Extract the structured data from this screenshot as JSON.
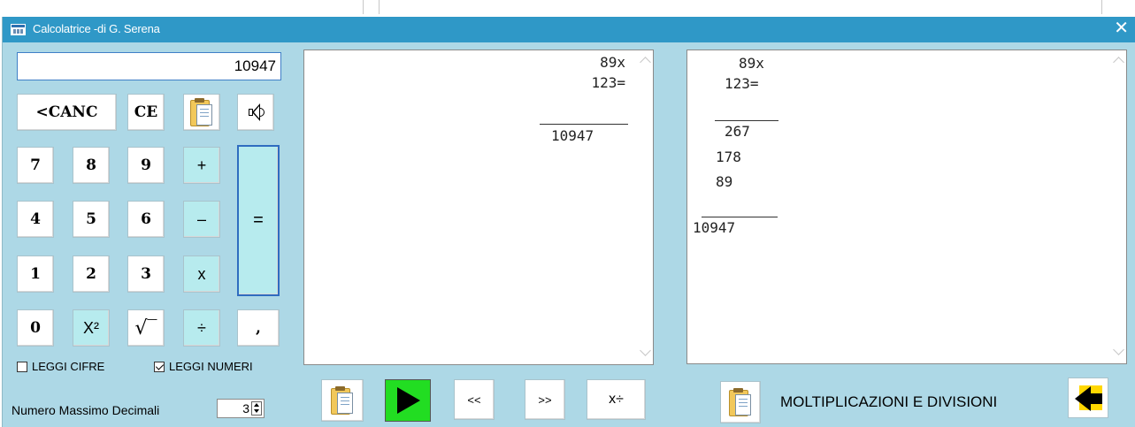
{
  "window": {
    "title": "Calcolatrice -di G. Serena",
    "close_label": "✕"
  },
  "display": {
    "value": "10947"
  },
  "keypad": {
    "cancel": "<CANC",
    "ce": "CE",
    "digits": [
      "0",
      "1",
      "2",
      "3",
      "4",
      "5",
      "6",
      "7",
      "8",
      "9"
    ],
    "plus": "+",
    "minus": "–",
    "times": "x",
    "divide": "÷",
    "equals": "=",
    "square": "X²",
    "sqrt": "√‾",
    "comma": ","
  },
  "options": {
    "leggi_cifre_label": "LEGGI CIFRE",
    "leggi_cifre_checked": false,
    "leggi_numeri_label": "LEGGI NUMERI",
    "leggi_numeri_checked": true,
    "max_decimals_label": "Numero Massimo Decimali",
    "max_decimals_value": "3"
  },
  "compact_panel": {
    "line1": "89x",
    "line2": "123=",
    "result": "10947"
  },
  "detail_panel": {
    "line1": "89x",
    "line2": "123=",
    "partials": [
      "267",
      "178",
      "89"
    ],
    "result": "10947"
  },
  "toolbar": {
    "prev_label": "<<",
    "next_label": ">>",
    "mode_label": "x÷",
    "section_title": "MOLTIPLICAZIONI E DIVISIONI"
  },
  "icons": [
    "clipboard-icon",
    "speaker-icon",
    "play-icon",
    "back-arrow-icon"
  ]
}
